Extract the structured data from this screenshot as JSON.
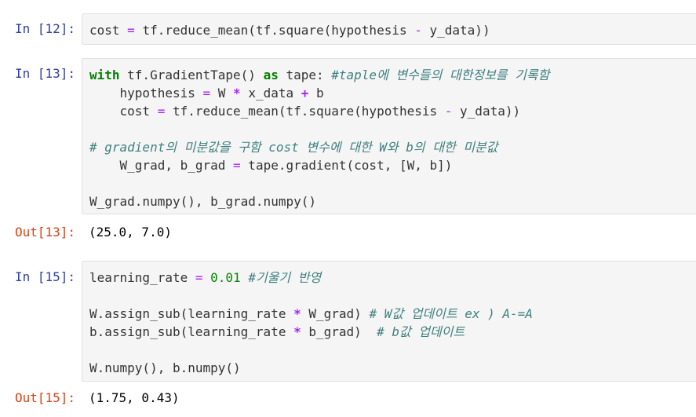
{
  "cells": {
    "c12": {
      "prompt": "In [12]:",
      "lines": [
        "cost = tf.reduce_mean(tf.square(hypothesis - y_data))"
      ]
    },
    "c13": {
      "prompt": "In [13]:",
      "lines": [
        "with tf.GradientTape() as tape: #taple에 변수들의 대한정보를 기록함",
        "    hypothesis = W * x_data + b",
        "    cost = tf.reduce_mean(tf.square(hypothesis - y_data))",
        "",
        "# gradient의 미분값을 구함 cost 변수에 대한 W와 b의 대한 미분값",
        "    W_grad, b_grad = tape.gradient(cost, [W, b])",
        "",
        "W_grad.numpy(), b_grad.numpy()"
      ],
      "out_prompt": "Out[13]:",
      "output": "(25.0, 7.0)"
    },
    "c15": {
      "prompt": "In [15]:",
      "lines": [
        "learning_rate = 0.01 #기울기 반영",
        "",
        "W.assign_sub(learning_rate * W_grad) # W값 업데이트 ex ) A-=A",
        "b.assign_sub(learning_rate * b_grad)  # b값 업데이트",
        "",
        "W.numpy(), b.numpy()"
      ],
      "out_prompt": "Out[15]:",
      "output": "(1.75, 0.43)"
    }
  },
  "colors": {
    "in_prompt": "#303f9f",
    "out_prompt": "#d84315",
    "keyword": "#008000",
    "operator": "#aa22ff",
    "comment": "#408080",
    "number": "#008800",
    "cell_bg": "#f5f5f5",
    "cell_border": "#e0e0e0"
  }
}
